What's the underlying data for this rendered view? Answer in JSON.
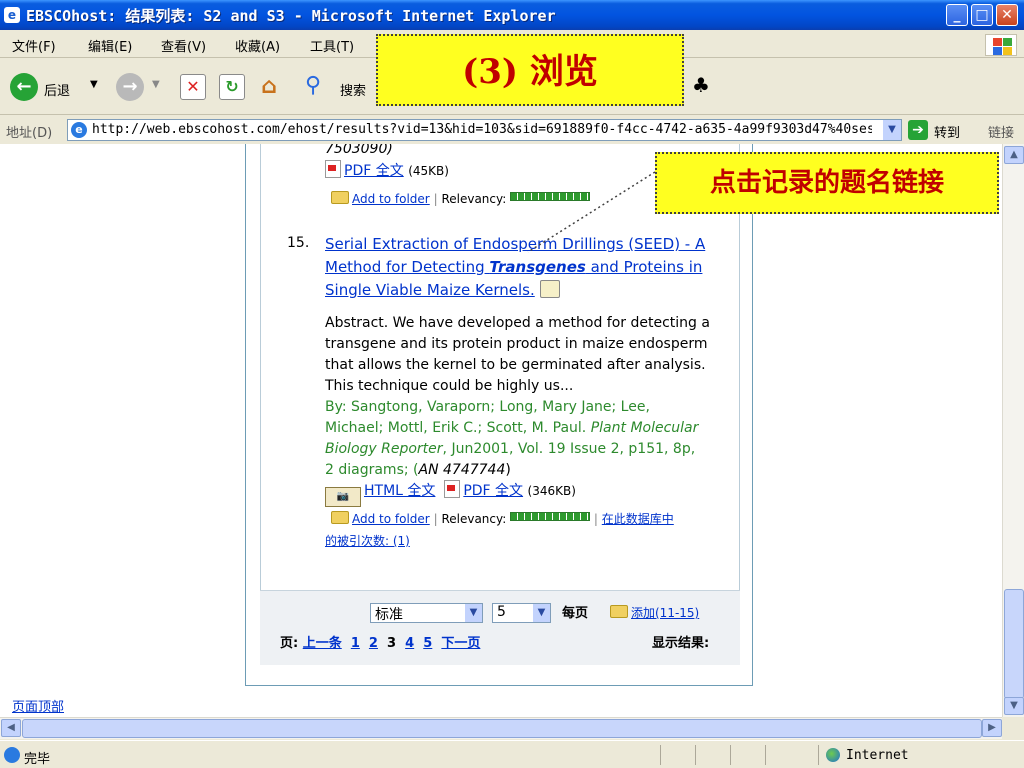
{
  "window": {
    "title": "EBSCOhost: 结果列表: S2 and S3 - Microsoft Internet Explorer",
    "controls": {
      "minimize": "_",
      "maximize": "□",
      "close": "✕"
    }
  },
  "menu": [
    "文件(F)",
    "编辑(E)",
    "查看(V)",
    "收藏(A)",
    "工具(T)"
  ],
  "toolbar": {
    "back_label": "后退",
    "search_label": "搜索",
    "overlay_title": "(3) 浏览"
  },
  "address": {
    "label": "地址(D)",
    "url": "http://web.ebscohost.com/ehost/results?vid=13&hid=103&sid=691889f0-f4cc-4742-a635-4a99f9303d47%40sessi",
    "go_label": "转到",
    "links_label": "链接"
  },
  "results": {
    "prev_tail": {
      "an": "7503090)",
      "pdf_label": "PDF 全文",
      "pdf_size": "(45KB)",
      "add_folder": "Add to folder",
      "relevancy_label": "Relevancy:",
      "relevancy": 1.0
    },
    "item": {
      "number": "15.",
      "title_line1": "Serial Extraction of Endosperm Drillings (SEED) - A",
      "title_line2_pre": "Method for Detecting ",
      "title_line2_em": "Transgenes",
      "title_line2_post": " and Proteins in",
      "title_line3": "Single Viable Maize Kernels.",
      "abstract": [
        "Abstract. We have developed a method for detecting a",
        "transgene and its protein product in maize endosperm",
        "that allows the kernel to be germinated after analysis.",
        "This technique could be highly us..."
      ],
      "byline1": "By: Sangtong, Varaporn; Long, Mary Jane; Lee,",
      "byline2_pre": "Michael; Mottl, Erik C.; Scott, M. Paul. ",
      "byline2_em": "Plant Molecular",
      "byline3_em": "Biology Reporter",
      "byline3_post": ", Jun2001, Vol. 19 Issue 2, p151, 8p,",
      "byline4_pre": "2 diagrams; (",
      "byline4_em": "AN 4747744",
      "byline4_post": ")",
      "html_label": "HTML 全文",
      "pdf_label": "PDF 全文",
      "pdf_size": "(346KB)",
      "add_folder": "Add to folder",
      "relevancy_label": "Relevancy:",
      "relevancy": 1.0,
      "cited_line1": "在此数据库中",
      "cited_line2": "的被引次数: (1)"
    }
  },
  "footer": {
    "sort_value": "标准",
    "per_page_value": "5",
    "per_page_label": "每页",
    "add_label": "添加(11-15)",
    "page_label": "页:",
    "prev_label": "上一条",
    "pages": [
      "1",
      "2",
      "3",
      "4",
      "5"
    ],
    "current_page": "3",
    "next_label": "下一页",
    "show_results": "显示结果:"
  },
  "callout_text": "点击记录的题名链接",
  "page_top_link": "页面顶部",
  "status": {
    "text": "完毕",
    "zone": "Internet"
  },
  "colors": {
    "titlebar": "#0254e0",
    "link": "#0033cc",
    "byline": "#2d8a2d",
    "callout_bg": "#ffff20",
    "callout_text": "#c00000"
  }
}
